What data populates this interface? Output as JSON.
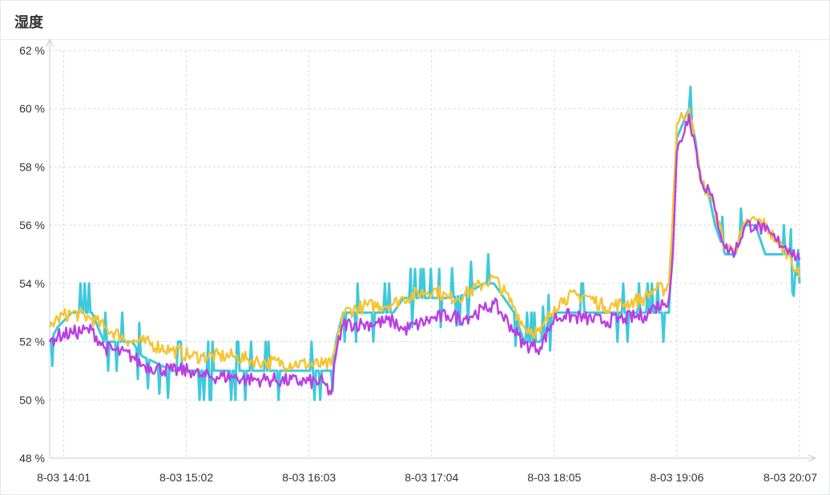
{
  "panel": {
    "title": "湿度"
  },
  "chart_data": {
    "type": "line",
    "title": "湿度",
    "xlabel": "",
    "ylabel": "",
    "y_unit": "%",
    "ylim": [
      48,
      62
    ],
    "y_ticks": [
      "48 %",
      "50 %",
      "52 %",
      "54 %",
      "56 %",
      "58 %",
      "60 %",
      "62 %"
    ],
    "x_range": [
      "8-03 13:54",
      "8-03 20:07"
    ],
    "x_ticks": [
      "8-03 14:01",
      "8-03 15:02",
      "8-03 16:03",
      "8-03 17:04",
      "8-03 18:05",
      "8-03 19:06",
      "8-03 20:07"
    ],
    "grid": true,
    "legend": "none",
    "series": [
      {
        "color": "#3ec9dc",
        "x": [
          "8-03 13:54",
          "8-03 13:58",
          "8-03 14:05",
          "8-03 14:15",
          "8-03 14:21",
          "8-03 14:35",
          "8-03 14:40",
          "8-03 14:55",
          "8-03 15:05",
          "8-03 15:10",
          "8-03 15:25",
          "8-03 15:32",
          "8-03 15:40",
          "8-03 16:10",
          "8-03 16:14",
          "8-03 16:17",
          "8-03 16:20",
          "8-03 16:30",
          "8-03 16:45",
          "8-03 16:50",
          "8-03 17:05",
          "8-03 17:12",
          "8-03 17:20",
          "8-03 17:30",
          "8-03 17:35",
          "8-03 17:45",
          "8-03 17:50",
          "8-03 17:58",
          "8-03 18:05",
          "8-03 18:10",
          "8-03 18:20",
          "8-03 18:30",
          "8-03 18:40",
          "8-03 18:50",
          "8-03 18:55",
          "8-03 19:00",
          "8-03 19:02",
          "8-03 19:04",
          "8-03 19:06",
          "8-03 19:12",
          "8-03 19:15",
          "8-03 19:18",
          "8-03 19:22",
          "8-03 19:25",
          "8-03 19:30",
          "8-03 19:35",
          "8-03 19:40",
          "8-03 19:45",
          "8-03 19:50",
          "8-03 19:55",
          "8-03 20:02",
          "8-03 20:07"
        ],
        "values": [
          52,
          52.5,
          53,
          53,
          52,
          52,
          51.5,
          51,
          51,
          51,
          51,
          51,
          51,
          51,
          51,
          52.2,
          53,
          53,
          53,
          53.5,
          53.5,
          53.5,
          53.6,
          54,
          54,
          53,
          52,
          52,
          53,
          53,
          53,
          53,
          53,
          53,
          53,
          53,
          53,
          56,
          59,
          60,
          59,
          57.5,
          57,
          56,
          55,
          55,
          56,
          56,
          55,
          55,
          55,
          54
        ]
      },
      {
        "color": "#f5c431",
        "x": [
          "8-03 13:54",
          "8-03 13:58",
          "8-03 14:05",
          "8-03 14:15",
          "8-03 14:21",
          "8-03 14:35",
          "8-03 14:40",
          "8-03 14:55",
          "8-03 15:05",
          "8-03 15:10",
          "8-03 15:25",
          "8-03 15:32",
          "8-03 15:40",
          "8-03 16:10",
          "8-03 16:14",
          "8-03 16:17",
          "8-03 16:20",
          "8-03 16:30",
          "8-03 16:45",
          "8-03 16:50",
          "8-03 17:05",
          "8-03 17:12",
          "8-03 17:20",
          "8-03 17:30",
          "8-03 17:35",
          "8-03 17:45",
          "8-03 17:50",
          "8-03 17:58",
          "8-03 18:05",
          "8-03 18:10",
          "8-03 18:20",
          "8-03 18:30",
          "8-03 18:40",
          "8-03 18:50",
          "8-03 18:55",
          "8-03 19:00",
          "8-03 19:02",
          "8-03 19:04",
          "8-03 19:06",
          "8-03 19:12",
          "8-03 19:15",
          "8-03 19:18",
          "8-03 19:22",
          "8-03 19:25",
          "8-03 19:30",
          "8-03 19:35",
          "8-03 19:40",
          "8-03 19:45",
          "8-03 19:50",
          "8-03 19:55",
          "8-03 20:02",
          "8-03 20:07"
        ],
        "values": [
          52.5,
          52.8,
          53,
          52.8,
          52.5,
          52,
          52,
          51.7,
          51.5,
          51.5,
          51.5,
          51.4,
          51.3,
          51.2,
          51.2,
          52,
          53,
          53.2,
          53.3,
          53.5,
          53.8,
          53.5,
          53.6,
          54,
          54.2,
          53.2,
          52.5,
          52.3,
          53.2,
          53.5,
          53.6,
          53.2,
          53.3,
          53.5,
          53.8,
          53.8,
          54,
          56.5,
          59.5,
          60,
          58.8,
          57.5,
          57,
          56.5,
          55.2,
          55.2,
          56,
          56.2,
          56,
          55.5,
          55,
          54.2
        ]
      },
      {
        "color": "#b93ee5",
        "x": [
          "8-03 13:54",
          "8-03 13:58",
          "8-03 14:05",
          "8-03 14:15",
          "8-03 14:21",
          "8-03 14:35",
          "8-03 14:40",
          "8-03 14:55",
          "8-03 15:05",
          "8-03 15:10",
          "8-03 15:25",
          "8-03 15:32",
          "8-03 15:40",
          "8-03 16:10",
          "8-03 16:14",
          "8-03 16:17",
          "8-03 16:20",
          "8-03 16:30",
          "8-03 16:45",
          "8-03 16:50",
          "8-03 17:05",
          "8-03 17:12",
          "8-03 17:20",
          "8-03 17:30",
          "8-03 17:35",
          "8-03 17:45",
          "8-03 17:50",
          "8-03 17:58",
          "8-03 18:05",
          "8-03 18:10",
          "8-03 18:20",
          "8-03 18:30",
          "8-03 18:40",
          "8-03 18:50",
          "8-03 18:55",
          "8-03 19:00",
          "8-03 19:02",
          "8-03 19:04",
          "8-03 19:06",
          "8-03 19:12",
          "8-03 19:15",
          "8-03 19:18",
          "8-03 19:22",
          "8-03 19:25",
          "8-03 19:30",
          "8-03 19:35",
          "8-03 19:40",
          "8-03 19:45",
          "8-03 19:50",
          "8-03 19:55",
          "8-03 20:02",
          "8-03 20:07"
        ],
        "values": [
          52,
          52.2,
          52.3,
          52.4,
          51.8,
          51.5,
          51.2,
          51,
          51,
          50.8,
          50.8,
          50.7,
          50.7,
          50.6,
          50.2,
          51.8,
          52.6,
          52.6,
          52.7,
          52.4,
          52.8,
          52.9,
          52.8,
          53.1,
          53.3,
          52.4,
          51.9,
          51.8,
          52.8,
          52.9,
          52.8,
          52.7,
          52.8,
          52.9,
          53.2,
          53.3,
          53.5,
          55,
          58.5,
          59.8,
          58.8,
          57.5,
          57.2,
          56.5,
          55.2,
          55.1,
          56,
          56,
          55.8,
          55.5,
          55.2,
          54.8
        ]
      }
    ]
  }
}
